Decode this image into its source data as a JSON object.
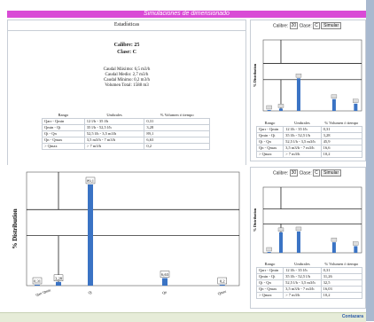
{
  "header": {
    "title": "Simulaciones de dimensionado"
  },
  "stats": {
    "title": "Estadísticas",
    "calibre_line": "Calibre: 25",
    "clase_line": "Clase: C",
    "lines": [
      "Caudal Máximo: 6,5 m3/h",
      "Caudal Medio: 2,7 m3/h",
      "Caudal Mínimo: 0,2 m3/h",
      "Volumen Total: 1588 m3"
    ]
  },
  "table": {
    "headers": [
      "Rango",
      "Umbrales",
      "% Volumen ó tiempo"
    ],
    "rows": [
      [
        "Qarr - Qmin",
        "12 l/h - 35 l/h",
        "0,31"
      ],
      [
        "Qmin - Qt",
        "35 l/h - 52,5 l/h",
        "3,28"
      ],
      [
        "Qt - Qn",
        "52,5 l/h - 3,5 m3/h",
        "89,1"
      ],
      [
        "Qn - Qmax",
        "3,5 m3/h - 7 m3/h",
        "6,63"
      ],
      [
        "> Qmax",
        "> 7 m3/h",
        "0,2"
      ]
    ]
  },
  "big_chart": {
    "ylabel": "% Distribution",
    "tick_labels": [
      "Qarr Qmin",
      "Qt",
      "Qn",
      "Qmax"
    ],
    "bar_labels": [
      "0,31",
      "3,28",
      "89,1",
      "6,63",
      "0,2"
    ]
  },
  "chart_data": [
    {
      "type": "bar",
      "categories": [
        "Qarr - Qmin",
        "Qmin - Qt",
        "Qt - Qn",
        "Qn - Qmax",
        "> Qmax"
      ],
      "values": [
        0.31,
        3.28,
        89.1,
        6.63,
        0.2
      ],
      "ylabel": "% Distribution",
      "ylim": [
        0,
        100
      ]
    },
    {
      "type": "bar",
      "categories": [
        "Qarr - Qmin",
        "Qmin - Qt",
        "Qt - Qn",
        "Qn - Qmax",
        "> Qmax"
      ],
      "values": [
        0.31,
        3.28,
        45.9,
        16.6,
        10.2
      ],
      "ylabel": "% Distribution",
      "ylim": [
        0,
        100
      ]
    },
    {
      "type": "bar",
      "categories": [
        "Qarr - Qmin",
        "Qmin - Qt",
        "Qt - Qn",
        "Qn - Qmax",
        "> Qmax"
      ],
      "values": [
        0.31,
        31.26,
        32.5,
        16.03,
        10.2
      ],
      "ylabel": "% Distribution",
      "ylim": [
        0,
        100
      ]
    }
  ],
  "right_top": {
    "calibre_label": "Calibre:",
    "calibre_value": "20",
    "clase_label": "Clase:",
    "clase_value": "C",
    "button": "Simular",
    "table_rows": [
      [
        "Qarr - Qmin",
        "12 l/h - 35 l/h",
        "0,31"
      ],
      [
        "Qmin - Qt",
        "35 l/h - 52,5 l/h",
        "3,28"
      ],
      [
        "Qt - Qn",
        "52,5 l/h - 3,5 m3/h",
        "45,9"
      ],
      [
        "Qn - Qmax",
        "3,5 m3/h - 7 m3/h",
        "16,6"
      ],
      [
        "> Qmax",
        "> 7 m3/h",
        "10,2"
      ]
    ]
  },
  "right_bottom": {
    "calibre_label": "Calibre:",
    "calibre_value": "30",
    "clase_label": "Clase:",
    "clase_value": "C",
    "button": "Simular",
    "table_rows": [
      [
        "Qarr - Qmin",
        "12 l/h - 35 l/h",
        "0,31"
      ],
      [
        "Qmin - Qt",
        "35 l/h - 52,5 l/h",
        "31,26"
      ],
      [
        "Qt - Qn",
        "52,5 l/h - 3,5 m3/h",
        "32,5"
      ],
      [
        "Qn - Qmax",
        "3,5 m3/h - 7 m3/h",
        "16,03"
      ],
      [
        "> Qmax",
        "> 7 m3/h",
        "10,2"
      ]
    ]
  },
  "footer": {
    "logo": "Contazara"
  }
}
